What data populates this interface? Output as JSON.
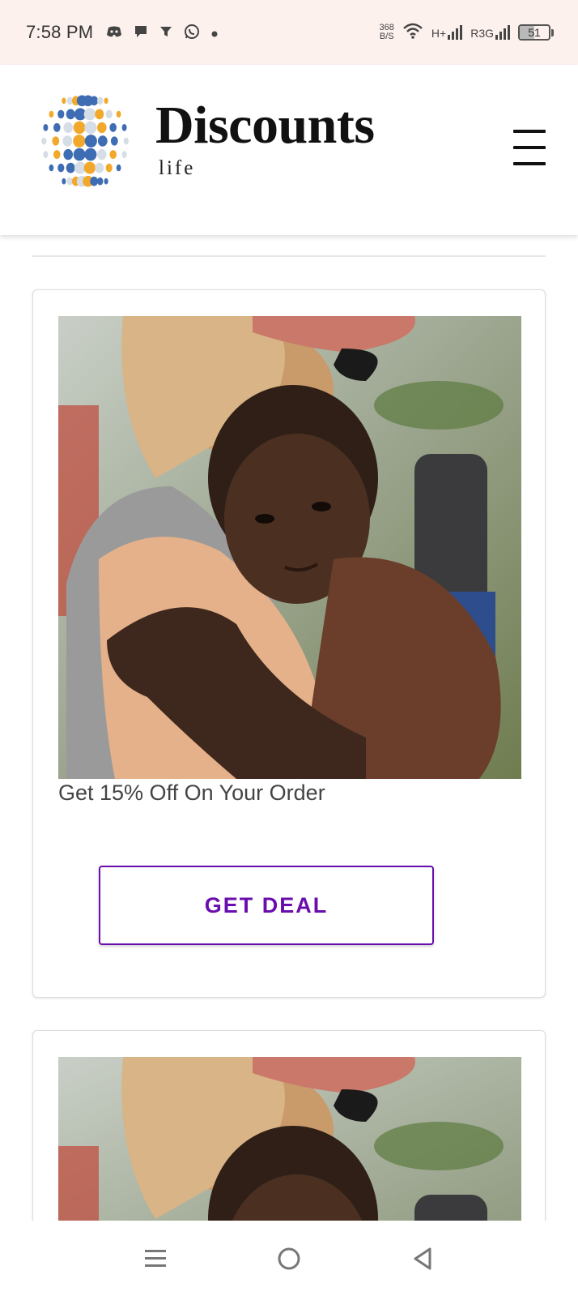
{
  "status_bar": {
    "time": "7:58 PM",
    "notification_icons": [
      "discord-icon",
      "chat-icon",
      "filter-icon",
      "whatsapp-icon",
      "dot-icon"
    ],
    "net_speed_value": "368",
    "net_speed_unit": "B/S",
    "wifi_icon": "wifi-icon",
    "network_1": "H+",
    "network_2": "R3G",
    "battery": "51",
    "battery_level": 0.51
  },
  "header": {
    "brand_name": "Discounts",
    "brand_sub": "life",
    "logo_colors": [
      "#3f6db3",
      "#f2a92b",
      "#d5dde6"
    ],
    "menu_icon": "hamburger-menu-icon"
  },
  "deals": [
    {
      "image_icon": "deal-photo",
      "title": "Get 15% Off On Your Order",
      "button_label": "GET DEAL"
    },
    {
      "image_icon": "deal-photo"
    }
  ],
  "nav_bar": {
    "icons": [
      "recents-icon",
      "home-icon",
      "back-icon"
    ]
  },
  "colors": {
    "accent": "#6a0dad",
    "status_bar_bg": "#fdf1ee"
  }
}
